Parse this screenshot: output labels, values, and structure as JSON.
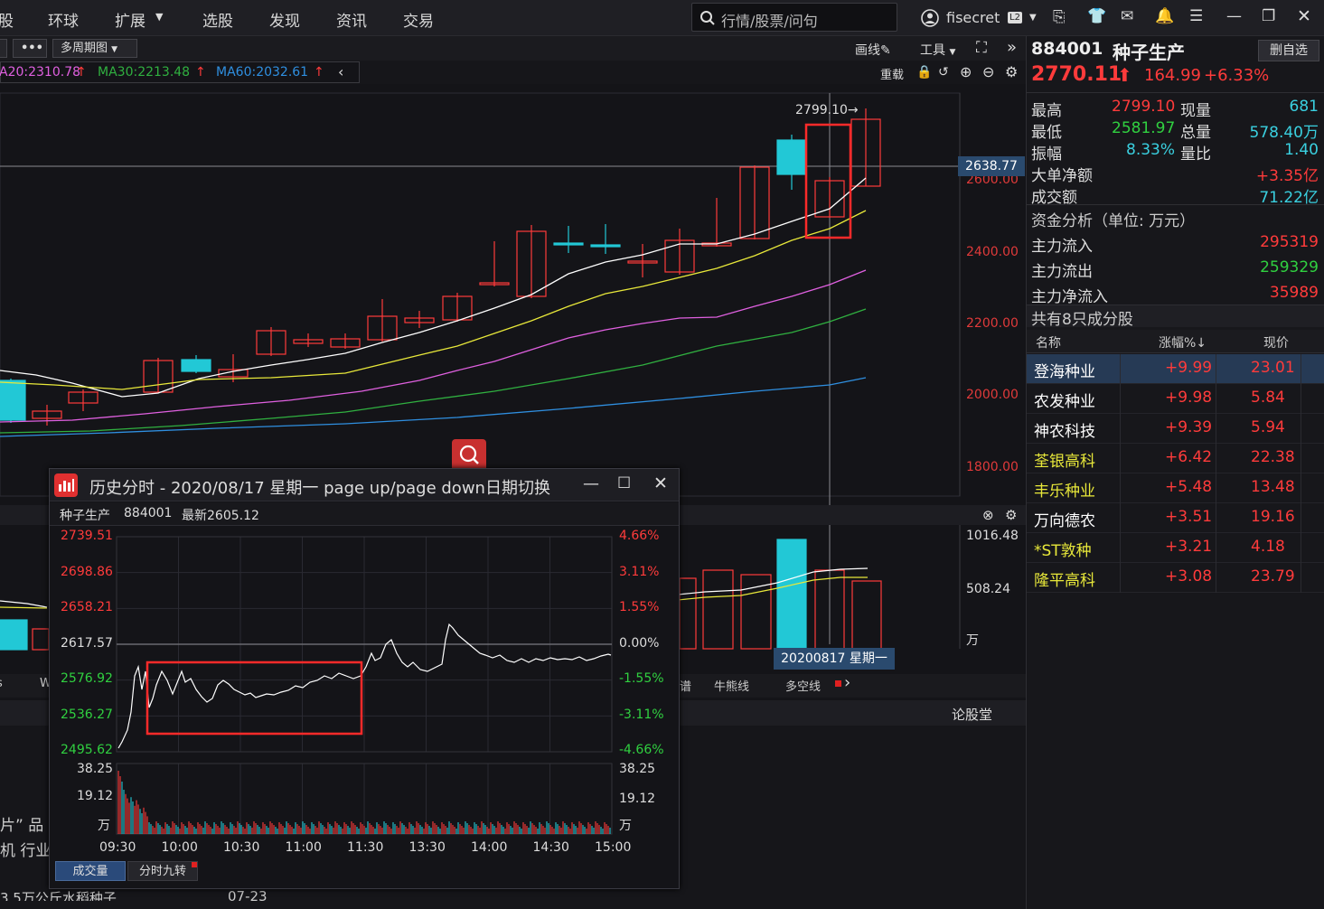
{
  "topmenu": [
    "股",
    "环球",
    "扩展",
    "选股",
    "发现",
    "资讯",
    "交易"
  ],
  "search_placeholder": "行情/股票/问句",
  "user": {
    "name": "fisecret",
    "badge": "L2"
  },
  "toolbar": {
    "more": "•••",
    "multi_period": "多周期图",
    "draw": "画线",
    "tools": "工具",
    "reload": "重载"
  },
  "ma": {
    "ma20": "A20:2310.78",
    "ma30": "MA30:2213.48",
    "ma60": "MA60:2032.61"
  },
  "colors": {
    "up": "#ff3b3b",
    "down": "#22c8d6",
    "ma5": "#ffffff",
    "ma10": "#e8e83a",
    "ma20": "#e060e0",
    "ma30": "#30b040",
    "ma60": "#2f8fe0",
    "bg": "#141418"
  },
  "main_chart": {
    "price_labels": [
      "2600.00",
      "2400.00",
      "2200.00",
      "2000.00",
      "1800.00"
    ],
    "crosshair_price": "2638.77",
    "high_marker": "2799.10",
    "vol_labels": [
      "1016.48",
      "508.24",
      "万"
    ],
    "date_label": "20200817 星期一",
    "bottom_tabs": [
      "W",
      "谱",
      "牛熊线",
      "多空线"
    ],
    "discussion": "论股堂",
    "news_fragments": [
      "片” 品",
      "机 行业",
      "3.5万公斤水稻种子",
      "07-23"
    ]
  },
  "quote": {
    "code": "884001",
    "name": "种子生产",
    "del_button": "删自选",
    "price": "2770.11",
    "change": "164.99",
    "change_pct": "+6.33%",
    "stats": [
      {
        "l": "最高",
        "v": "2799.10",
        "l2": "现量",
        "v2": "681"
      },
      {
        "l": "最低",
        "v": "2581.97",
        "l2": "总量",
        "v2": "578.40万"
      },
      {
        "l": "振幅",
        "v": "8.33%",
        "l2": "量比",
        "v2": "1.40"
      }
    ],
    "big_order": {
      "l": "大单净额",
      "v": "+3.35亿"
    },
    "turnover": {
      "l": "成交额",
      "v": "71.22亿"
    },
    "fund_title": "资金分析（单位: 万元）",
    "fund": [
      {
        "l": "主力流入",
        "v": "295319"
      },
      {
        "l": "主力流出",
        "v": "259329"
      },
      {
        "l": "主力净流入",
        "v": "35989"
      }
    ],
    "constituent_title": "共有8只成分股",
    "headers": [
      "名称",
      "涨幅%↓",
      "现价"
    ],
    "stocks": [
      {
        "name": "登海种业",
        "pct": "+9.99",
        "price": "23.01"
      },
      {
        "name": "农发种业",
        "pct": "+9.98",
        "price": "5.84"
      },
      {
        "name": "神农科技",
        "pct": "+9.39",
        "price": "5.94"
      },
      {
        "name": "荃银高科",
        "pct": "+6.42",
        "price": "22.38"
      },
      {
        "name": "丰乐种业",
        "pct": "+5.48",
        "price": "13.48"
      },
      {
        "name": "万向德农",
        "pct": "+3.51",
        "price": "19.16"
      },
      {
        "name": "*ST敦种",
        "pct": "+3.21",
        "price": "4.18"
      },
      {
        "name": "隆平高科",
        "pct": "+3.08",
        "price": "23.79"
      }
    ]
  },
  "popup": {
    "title": "历史分时 - 2020/08/17 星期一 page up/page down日期切换",
    "info_name": "种子生产",
    "info_code": "884001",
    "info_latest": "最新2605.12",
    "price_ticks": [
      "2739.51",
      "2698.86",
      "2658.21",
      "2617.57",
      "2576.92",
      "2536.27",
      "2495.62"
    ],
    "pct_ticks": [
      "4.66%",
      "3.11%",
      "1.55%",
      "0.00%",
      "-1.55%",
      "-3.11%",
      "-4.66%"
    ],
    "vol_ticks": [
      "38.25",
      "19.12",
      "万"
    ],
    "time_ticks": [
      "09:30",
      "10:00",
      "10:30",
      "11:00",
      "11:30",
      "13:30",
      "14:00",
      "14:30",
      "15:00"
    ],
    "tab_volume": "成交量",
    "tab_nine": "分时九转"
  }
}
